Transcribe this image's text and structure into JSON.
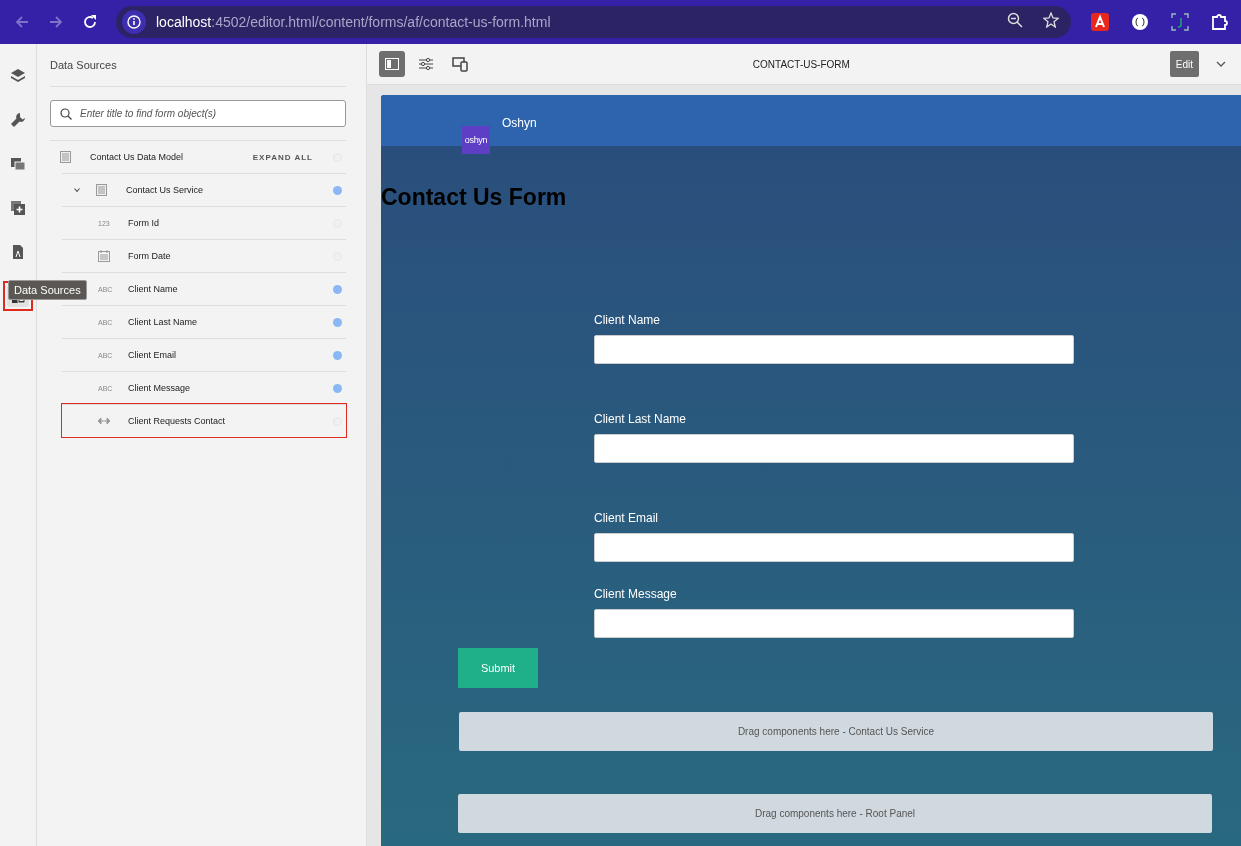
{
  "browser": {
    "url_host": "localhost",
    "url_path": ":4502/editor.html/content/forms/af/contact-us-form.html"
  },
  "rail": {
    "items": [
      {
        "kind": "layers",
        "selected": false,
        "highlighted": false
      },
      {
        "kind": "wrench",
        "selected": false,
        "highlighted": false
      },
      {
        "kind": "assets",
        "selected": false,
        "highlighted": false
      },
      {
        "kind": "add",
        "selected": false,
        "highlighted": false
      },
      {
        "kind": "document",
        "selected": false,
        "highlighted": false
      },
      {
        "kind": "datasource",
        "selected": true,
        "highlighted": true
      }
    ],
    "tooltip": "Data Sources"
  },
  "panel": {
    "title": "Data Sources",
    "search": {
      "placeholder": "Enter title to find form object(s)"
    },
    "expand_all": "EXPAND ALL",
    "tree": [
      {
        "label": "Contact Us Data Model",
        "kind": "model",
        "bound": false,
        "highlighted": false,
        "children": [
          {
            "label": "Contact Us Service",
            "kind": "model",
            "bound": true,
            "expanded": true,
            "highlighted": false,
            "children": [
              {
                "label": "Form Id",
                "kind": "number",
                "type_text": "123",
                "bound": false,
                "highlighted": false
              },
              {
                "label": "Form Date",
                "kind": "date",
                "bound": false,
                "highlighted": false
              },
              {
                "label": "Client Name",
                "kind": "text",
                "type_text": "ABC",
                "bound": true,
                "highlighted": false
              },
              {
                "label": "Client Last Name",
                "kind": "text",
                "type_text": "ABC",
                "bound": true,
                "highlighted": false
              },
              {
                "label": "Client Email",
                "kind": "text",
                "type_text": "ABC",
                "bound": true,
                "highlighted": false
              },
              {
                "label": "Client Message",
                "kind": "text",
                "type_text": "ABC",
                "bound": true,
                "highlighted": false
              },
              {
                "label": "Client Requests Contact",
                "kind": "toggle",
                "bound": false,
                "highlighted": true
              }
            ]
          }
        ]
      }
    ]
  },
  "toolbar": {
    "buttons": [
      {
        "kind": "sidepanel",
        "selected": true
      },
      {
        "kind": "properties",
        "selected": false
      },
      {
        "kind": "devices",
        "selected": false
      }
    ],
    "title": "CONTACT-US-FORM",
    "mode": "Edit"
  },
  "form": {
    "brand": "Oshyn",
    "logo_text": "oshyn",
    "heading": "Contact Us Form",
    "fields": [
      {
        "label": "Client Name"
      },
      {
        "label": "Client Last Name"
      },
      {
        "label": "Client Email"
      },
      {
        "label": "Client Message"
      }
    ],
    "submit": "Submit",
    "drop_zones": [
      "Drag components here - Contact Us Service",
      "Drag components here - Root Panel"
    ]
  }
}
